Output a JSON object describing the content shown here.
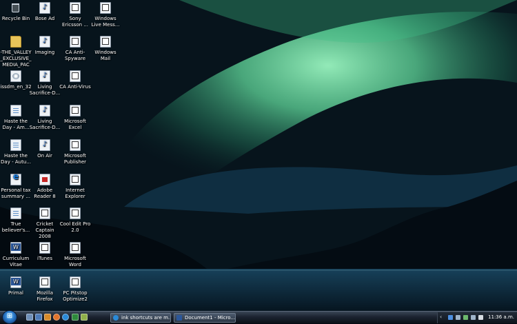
{
  "desktop": {
    "icons": [
      {
        "label": "Recycle Bin",
        "type": "bin"
      },
      {
        "label": "-THE_VALLEY_EXCLUSIVE_MEDIA_PAC",
        "type": "folder"
      },
      {
        "label": "issdm_en_32",
        "type": "iso"
      },
      {
        "label": "Haste the Day - Am...",
        "type": "doc"
      },
      {
        "label": "Haste the Day - Autu...",
        "type": "doc"
      },
      {
        "label": "Personal tax summary ...",
        "type": "ie"
      },
      {
        "label": "True believer's...",
        "type": "doc"
      },
      {
        "label": "Curriculum Vitae",
        "type": "word"
      },
      {
        "label": "Primal",
        "type": "word"
      },
      {
        "label": "Bose Ad",
        "type": "mp3"
      },
      {
        "label": "Imaging",
        "type": "mp3"
      },
      {
        "label": "Living Sacrifice-D...",
        "type": "mp3"
      },
      {
        "label": "Living Sacrifice-D...",
        "type": "mp3"
      },
      {
        "label": "On Air",
        "type": "mp3"
      },
      {
        "label": "Adobe Reader 8",
        "type": "pdf"
      },
      {
        "label": "Cricket Captain 2008",
        "type": "exe"
      },
      {
        "label": "iTunes",
        "type": "exe"
      },
      {
        "label": "Mozilla Firefox",
        "type": "exe"
      },
      {
        "label": "Sony Ericsson ...",
        "type": "exe"
      },
      {
        "label": "CA Anti-Spyware",
        "type": "exe"
      },
      {
        "label": "CA Anti-Virus",
        "type": "exe"
      },
      {
        "label": "Microsoft Excel",
        "type": "exe"
      },
      {
        "label": "Microsoft Publisher",
        "type": "exe"
      },
      {
        "label": "Internet Explorer",
        "type": "exe"
      },
      {
        "label": "Cool Edit Pro 2.0",
        "type": "exe"
      },
      {
        "label": "Microsoft Word",
        "type": "exe"
      },
      {
        "label": "PC Pitstop Optimize2",
        "type": "exe"
      },
      {
        "label": "Windows Live Mess...",
        "type": "exe"
      },
      {
        "label": "Windows Mail",
        "type": "exe"
      }
    ]
  },
  "taskbar": {
    "start_icon": "windows-start-orb",
    "quick_launch": [
      "show-desktop-icon",
      "switch-windows-icon",
      "media-icon",
      "firefox-icon",
      "ie-icon",
      "excel-icon",
      "mail-icon"
    ],
    "tasks": [
      {
        "label": "ink shortcuts are m...",
        "icon": "ie-icon"
      },
      {
        "label": "Document1 - Micro...",
        "icon": "word-icon"
      }
    ],
    "clock": "11:36 a.m."
  },
  "colors": {
    "aurora": "#6fe3a0",
    "taskbar": "#1b2330",
    "icon_label": "#ffffff"
  }
}
